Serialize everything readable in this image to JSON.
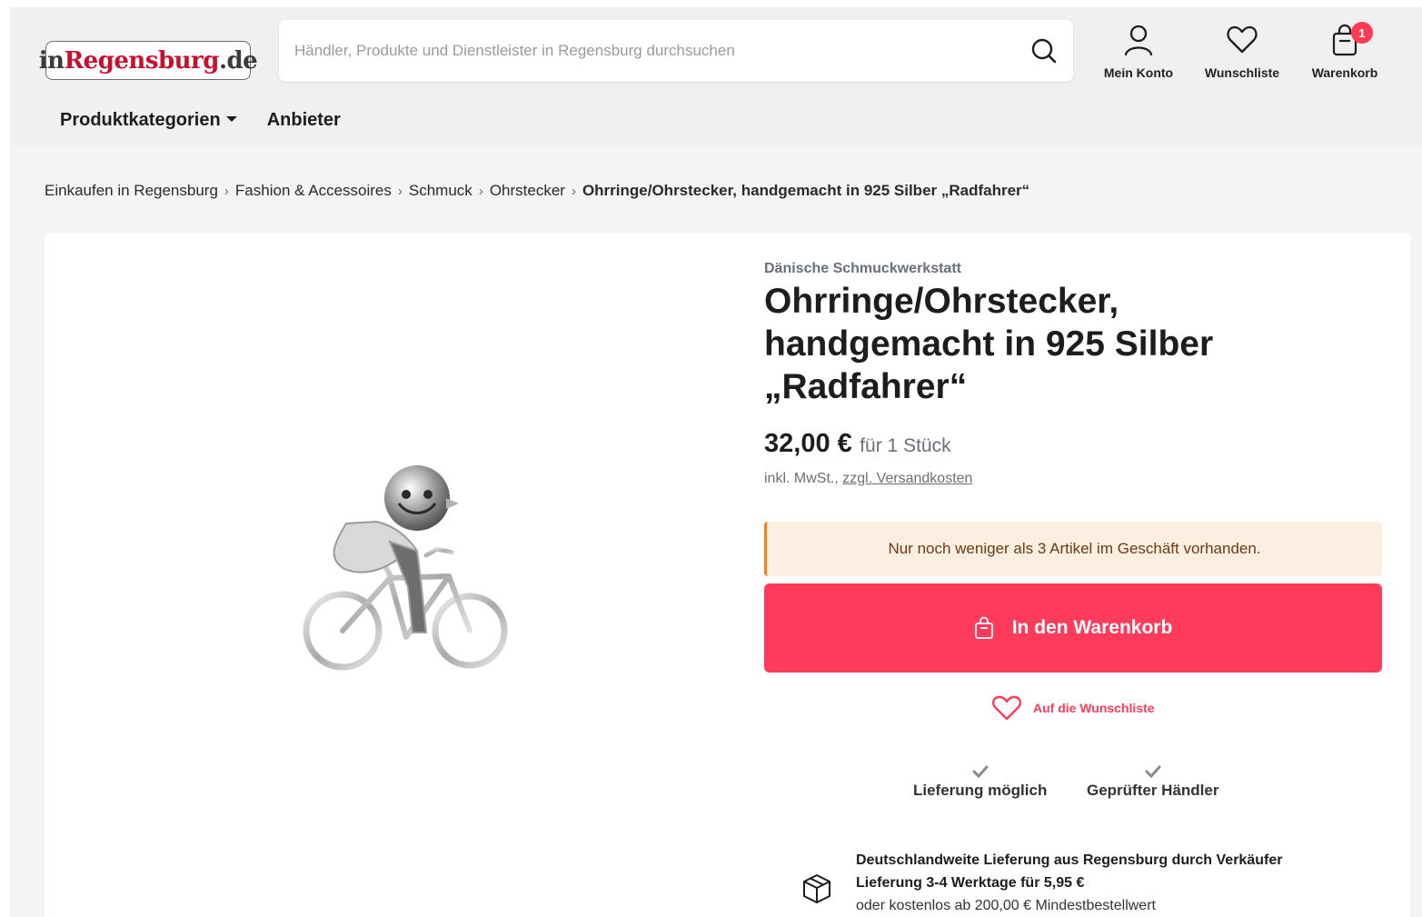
{
  "header": {
    "logo": {
      "part1": "in",
      "part2": "Regensburg",
      "part3": ".de"
    },
    "search_placeholder": "Händler, Produkte und Dienstleister in Regensburg durchsuchen",
    "account_label": "Mein Konto",
    "wishlist_label": "Wunschliste",
    "cart_label": "Warenkorb",
    "cart_count": "1"
  },
  "nav": {
    "categories_label": "Produktkategorien",
    "vendors_label": "Anbieter"
  },
  "breadcrumb": {
    "items": [
      "Einkaufen in Regensburg",
      "Fashion & Accessoires",
      "Schmuck",
      "Ohrstecker"
    ],
    "current": "Ohrringe/Ohrstecker, handgemacht in 925 Silber „Radfahrer“",
    "separator": "›"
  },
  "product": {
    "vendor": "Dänische Schmuckwerkstatt",
    "title": "Ohrringe/Ohrstecker, handgemacht in 925 Silber „Radfahrer“",
    "price": "32,00 €",
    "unit": "für 1 Stück",
    "tax_prefix": "inkl. MwSt.,",
    "shipping_link": "zzgl. Versandkosten",
    "stock_notice": "Nur noch weniger als 3 Artikel im Geschäft vorhanden.",
    "add_to_cart": "In den Warenkorb",
    "add_to_wishlist": "Auf die Wunschliste",
    "features": [
      "Lieferung möglich",
      "Geprüfter Händler"
    ],
    "shipping": {
      "line1": "Deutschlandweite Lieferung aus Regensburg durch Verkäufer",
      "line2": "Lieferung 3-4 Werktage für 5,95 €",
      "line3": "oder kostenlos ab 200,00 € Mindestbestellwert"
    }
  },
  "colors": {
    "accent": "#ff3b5c",
    "stock_bg": "#fdeee2",
    "stock_border": "#ff7a1a",
    "logo_red": "#c8102e"
  }
}
